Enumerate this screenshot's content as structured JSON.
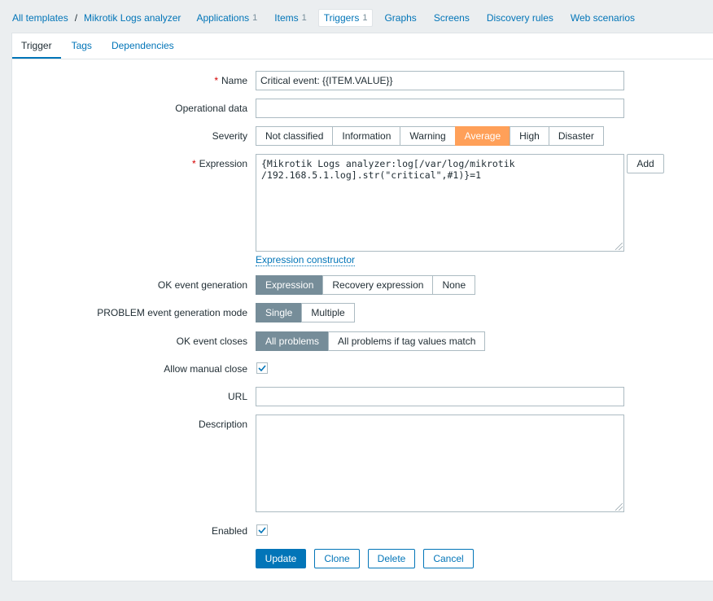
{
  "breadcrumb": {
    "all_templates": "All templates",
    "separator": "/",
    "template_name": "Mikrotik Logs analyzer"
  },
  "nav_tabs": [
    {
      "label": "Applications",
      "count": "1"
    },
    {
      "label": "Items",
      "count": "1"
    },
    {
      "label": "Triggers",
      "count": "1"
    },
    {
      "label": "Graphs",
      "count": ""
    },
    {
      "label": "Screens",
      "count": ""
    },
    {
      "label": "Discovery rules",
      "count": ""
    },
    {
      "label": "Web scenarios",
      "count": ""
    }
  ],
  "sub_tabs": [
    "Trigger",
    "Tags",
    "Dependencies"
  ],
  "form": {
    "name_label": "Name",
    "name_value": "Critical event: {{ITEM.VALUE}}",
    "opdata_label": "Operational data",
    "opdata_value": "",
    "severity_label": "Severity",
    "severity_options": [
      "Not classified",
      "Information",
      "Warning",
      "Average",
      "High",
      "Disaster"
    ],
    "severity_selected": "Average",
    "expression_label": "Expression",
    "expression_value": "{Mikrotik Logs analyzer:log[/var/log/mikrotik\n/192.168.5.1.log].str(\"critical\",#1)}=1",
    "add_button": "Add",
    "expression_constructor": "Expression constructor",
    "ok_event_gen_label": "OK event generation",
    "ok_event_gen_options": [
      "Expression",
      "Recovery expression",
      "None"
    ],
    "ok_event_gen_selected": "Expression",
    "problem_mode_label": "PROBLEM event generation mode",
    "problem_mode_options": [
      "Single",
      "Multiple"
    ],
    "problem_mode_selected": "Single",
    "ok_closes_label": "OK event closes",
    "ok_closes_options": [
      "All problems",
      "All problems if tag values match"
    ],
    "ok_closes_selected": "All problems",
    "manual_close_label": "Allow manual close",
    "manual_close_checked": true,
    "url_label": "URL",
    "url_value": "",
    "description_label": "Description",
    "description_value": "",
    "enabled_label": "Enabled",
    "enabled_checked": true
  },
  "buttons": {
    "update": "Update",
    "clone": "Clone",
    "delete": "Delete",
    "cancel": "Cancel"
  },
  "colors": {
    "accent": "#0275b8",
    "severity_average": "#ffa059",
    "selected_segment": "#768d99",
    "required": "#d40000"
  }
}
